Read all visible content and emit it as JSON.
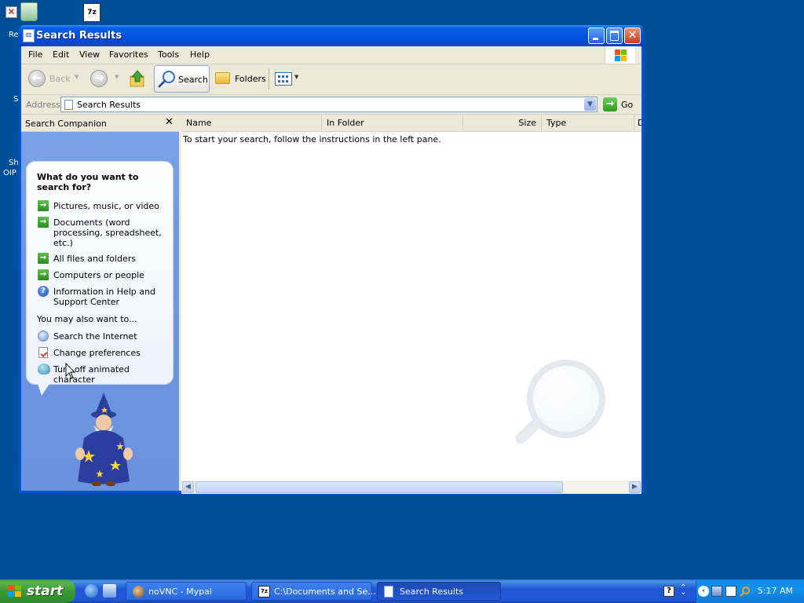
{
  "desktop": {
    "labels": [
      "Re",
      "S",
      "Sh",
      "OIP"
    ]
  },
  "window": {
    "title": "Search Results"
  },
  "menubar": {
    "items": [
      "File",
      "Edit",
      "View",
      "Favorites",
      "Tools",
      "Help"
    ]
  },
  "toolbar": {
    "back_label": "Back",
    "search_label": "Search",
    "folders_label": "Folders"
  },
  "address": {
    "label": "Address",
    "value": "Search Results",
    "go_label": "Go"
  },
  "companion": {
    "title": "Search Companion",
    "close_glyph": "✕",
    "question": "What do you want to search for?",
    "options": [
      "Pictures, music, or video",
      "Documents (word processing, spreadsheet, etc.)",
      "All files and folders",
      "Computers or people",
      "Information in Help and Support Center"
    ],
    "also_label": "You may also want to...",
    "also_options": [
      "Search the Internet",
      "Change preferences",
      "Turn off animated character"
    ]
  },
  "results": {
    "columns": [
      "Name",
      "In Folder",
      "Size",
      "Type",
      "D"
    ],
    "message": "To start your search, follow the instructions in the left pane."
  },
  "taskbar": {
    "start_label": "start",
    "tasks": [
      {
        "label": "noVNC - Mypal",
        "active": false
      },
      {
        "label": "C:\\Documents and Se...",
        "active": false
      },
      {
        "label": "Search Results",
        "active": true
      }
    ],
    "clock": "5:17 AM"
  },
  "colors": {
    "desktop": "#004e98",
    "titlebar": "#0054e3",
    "pane": "#6d96e0",
    "taskbar": "#2157d7",
    "start": "#3c9a34"
  }
}
